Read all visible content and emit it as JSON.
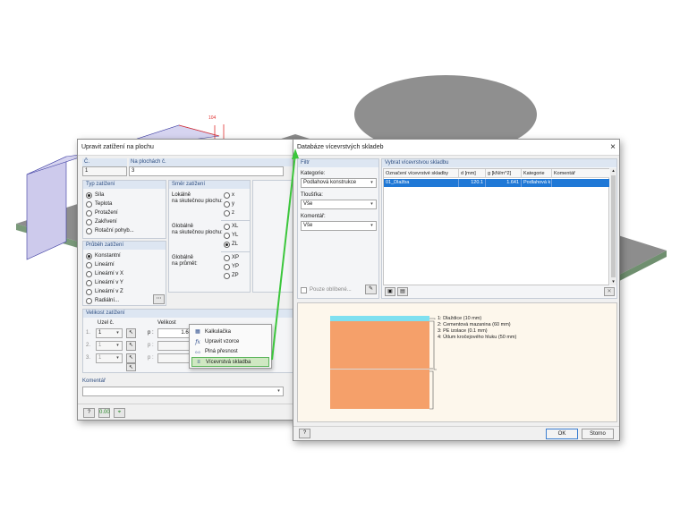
{
  "background": {
    "dim_label": "104",
    "colors": {
      "plate": "#8a8a8a",
      "cyl": "#8e8e8e",
      "load": "#c9c7ea",
      "dim": "#e03030"
    }
  },
  "editor": {
    "title": "Upravit zatížení na plochu",
    "no_label": "Č.",
    "no_value": "1",
    "surfaces_label": "Na plochách č.",
    "surfaces_value": "3",
    "load_type": {
      "header": "Typ zatížení",
      "options": [
        "Síla",
        "Teplota",
        "Protažení",
        "Zakřivení",
        "Rotační pohyb..."
      ],
      "selected": 0
    },
    "direction": {
      "header": "Směr zatížení",
      "local_label": [
        "Lokálně",
        "na skutečnou plochu:"
      ],
      "local_options": [
        "x",
        "y",
        "z"
      ],
      "global_true_label": [
        "Globálně",
        "na skutečnou plochu:"
      ],
      "global_true_options": [
        "XL",
        "YL",
        "ZL"
      ],
      "global_proj_label": [
        "Globálně",
        "na průmět:"
      ],
      "global_proj_options": [
        "XP",
        "YP",
        "ZP"
      ],
      "selected": "ZL"
    },
    "distribution": {
      "header": "Průběh zatížení",
      "options": [
        "Konstantní",
        "Lineární",
        "Lineární v X",
        "Lineární v Y",
        "Lineární v Z",
        "Radiální..."
      ],
      "selected": 0
    },
    "magnitude": {
      "header": "Velikost zatížení",
      "node_header": "Uzel č.",
      "value_header": "Velikost",
      "rows": [
        {
          "num": "1.",
          "node": "1",
          "sym": "p :",
          "value": "1.64"
        },
        {
          "num": "2.",
          "node": "1",
          "sym": "p :",
          "value": ""
        },
        {
          "num": "3.",
          "node": "1",
          "sym": "p :",
          "value": ""
        }
      ]
    },
    "comment_label": "Komentář",
    "comment_value": ""
  },
  "context_menu": {
    "items": [
      {
        "label": "Kalkulačka",
        "icon": "calculator-icon",
        "glyph": "▦"
      },
      {
        "label": "Upravit vzorce",
        "icon": "formula-icon",
        "glyph": "fx"
      },
      {
        "label": "Plná přesnost",
        "icon": "precision-icon",
        "glyph": "0.0"
      },
      {
        "label": "Vícevrstvá skladba",
        "icon": "layers-icon",
        "glyph": "≡"
      }
    ],
    "highlighted": 3
  },
  "database": {
    "title": "Databáze vícevrstvých skladeb",
    "filter_header": "Filtr",
    "category_label": "Kategorie:",
    "category_value": "Podlahová konstrukce",
    "thickness_label": "Tloušťka:",
    "thickness_value": "Vše",
    "comment_label": "Komentář:",
    "comment_value": "Vše",
    "favorites_label": "Pouze oblíbené...",
    "table_header": "Vybrat vícevrstvou skladbu",
    "columns": [
      "Označení vícevrstvé skladby",
      "d [mm]",
      "g [kN/m^2]",
      "Kategorie",
      "Komentář"
    ],
    "rows": [
      [
        "01_Dlažba",
        "120.1",
        "1.641",
        "Podlahová k",
        ""
      ]
    ],
    "legend": [
      "1: Dlaždice (10 mm)",
      "2: Cementová mazanina (60 mm)",
      "3: PE izolace (0.1 mm)",
      "4: Útlum kročejového hluku (50 mm)"
    ],
    "layer_colors": [
      "#7fe0f0",
      "#f5a06a",
      "#f5a06a",
      "#f5a06a"
    ],
    "ok_label": "OK",
    "cancel_label": "Storno"
  }
}
